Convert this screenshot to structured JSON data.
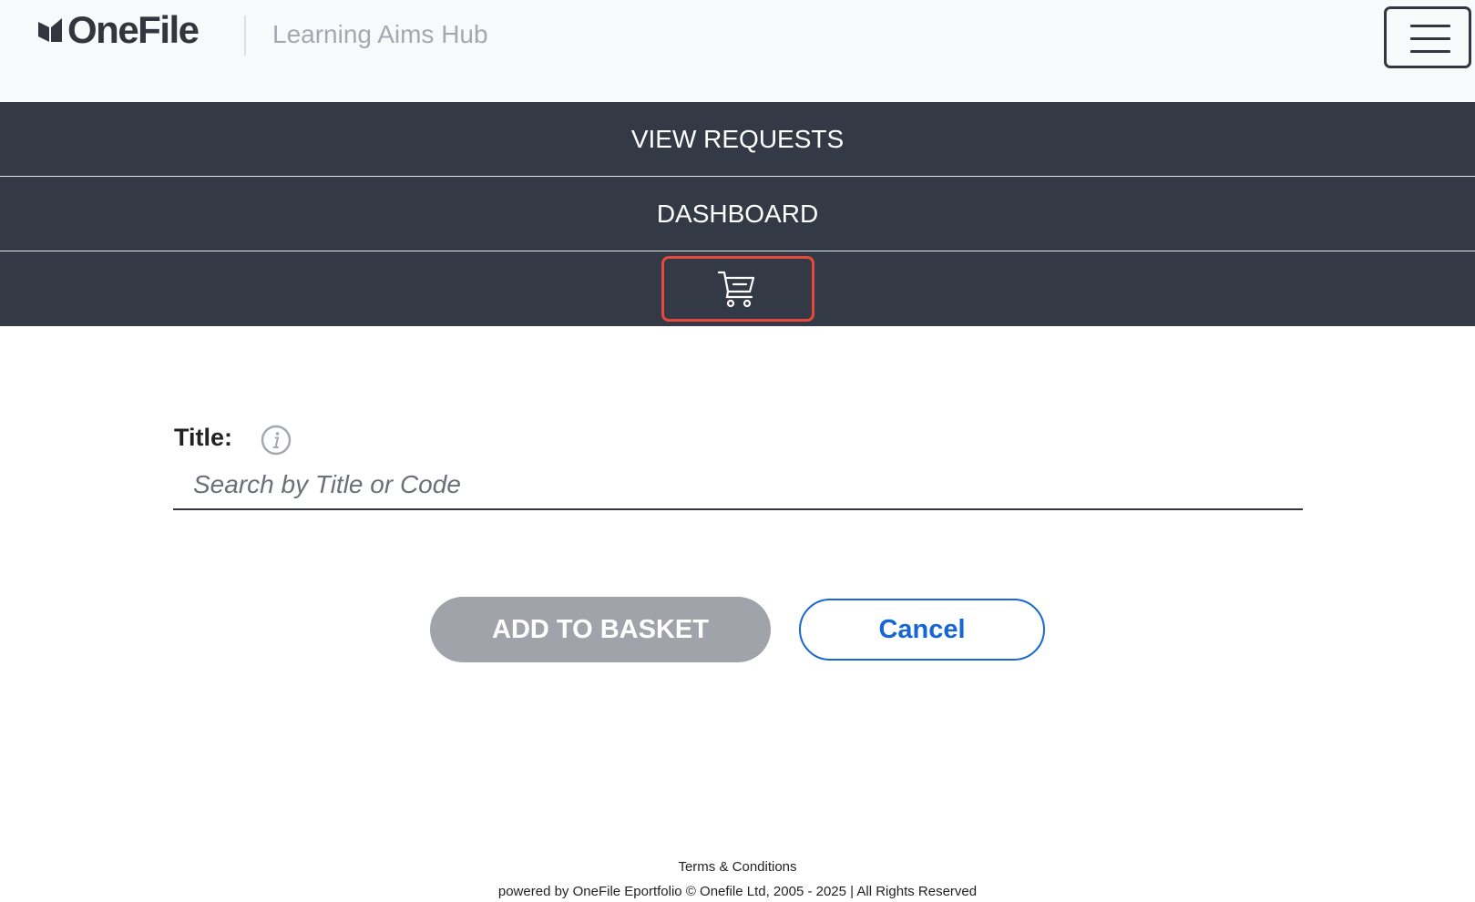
{
  "header": {
    "logo_text": "OneFile",
    "app_title": "Learning Aims Hub",
    "menu_icon": "hamburger-menu-icon"
  },
  "nav": {
    "items": [
      {
        "label": "VIEW REQUESTS"
      },
      {
        "label": "DASHBOARD"
      }
    ],
    "basket_icon": "shopping-cart-icon",
    "basket_highlight_color": "#e8473c"
  },
  "form": {
    "title_label": "Title:",
    "info_icon": "info-icon",
    "search_placeholder": "Search by Title or Code",
    "search_value": ""
  },
  "actions": {
    "add_label": "ADD TO BASKET",
    "cancel_label": "Cancel"
  },
  "footer": {
    "terms": "Terms & Conditions",
    "copyright": "powered by OneFile Eportfolio © Onefile Ltd, 2005 - 2025 | All Rights Reserved"
  },
  "colors": {
    "nav_background": "#343a45",
    "header_background": "#f8f9fb",
    "primary_link": "#1667d4",
    "disabled_button": "#a0a4aa"
  }
}
